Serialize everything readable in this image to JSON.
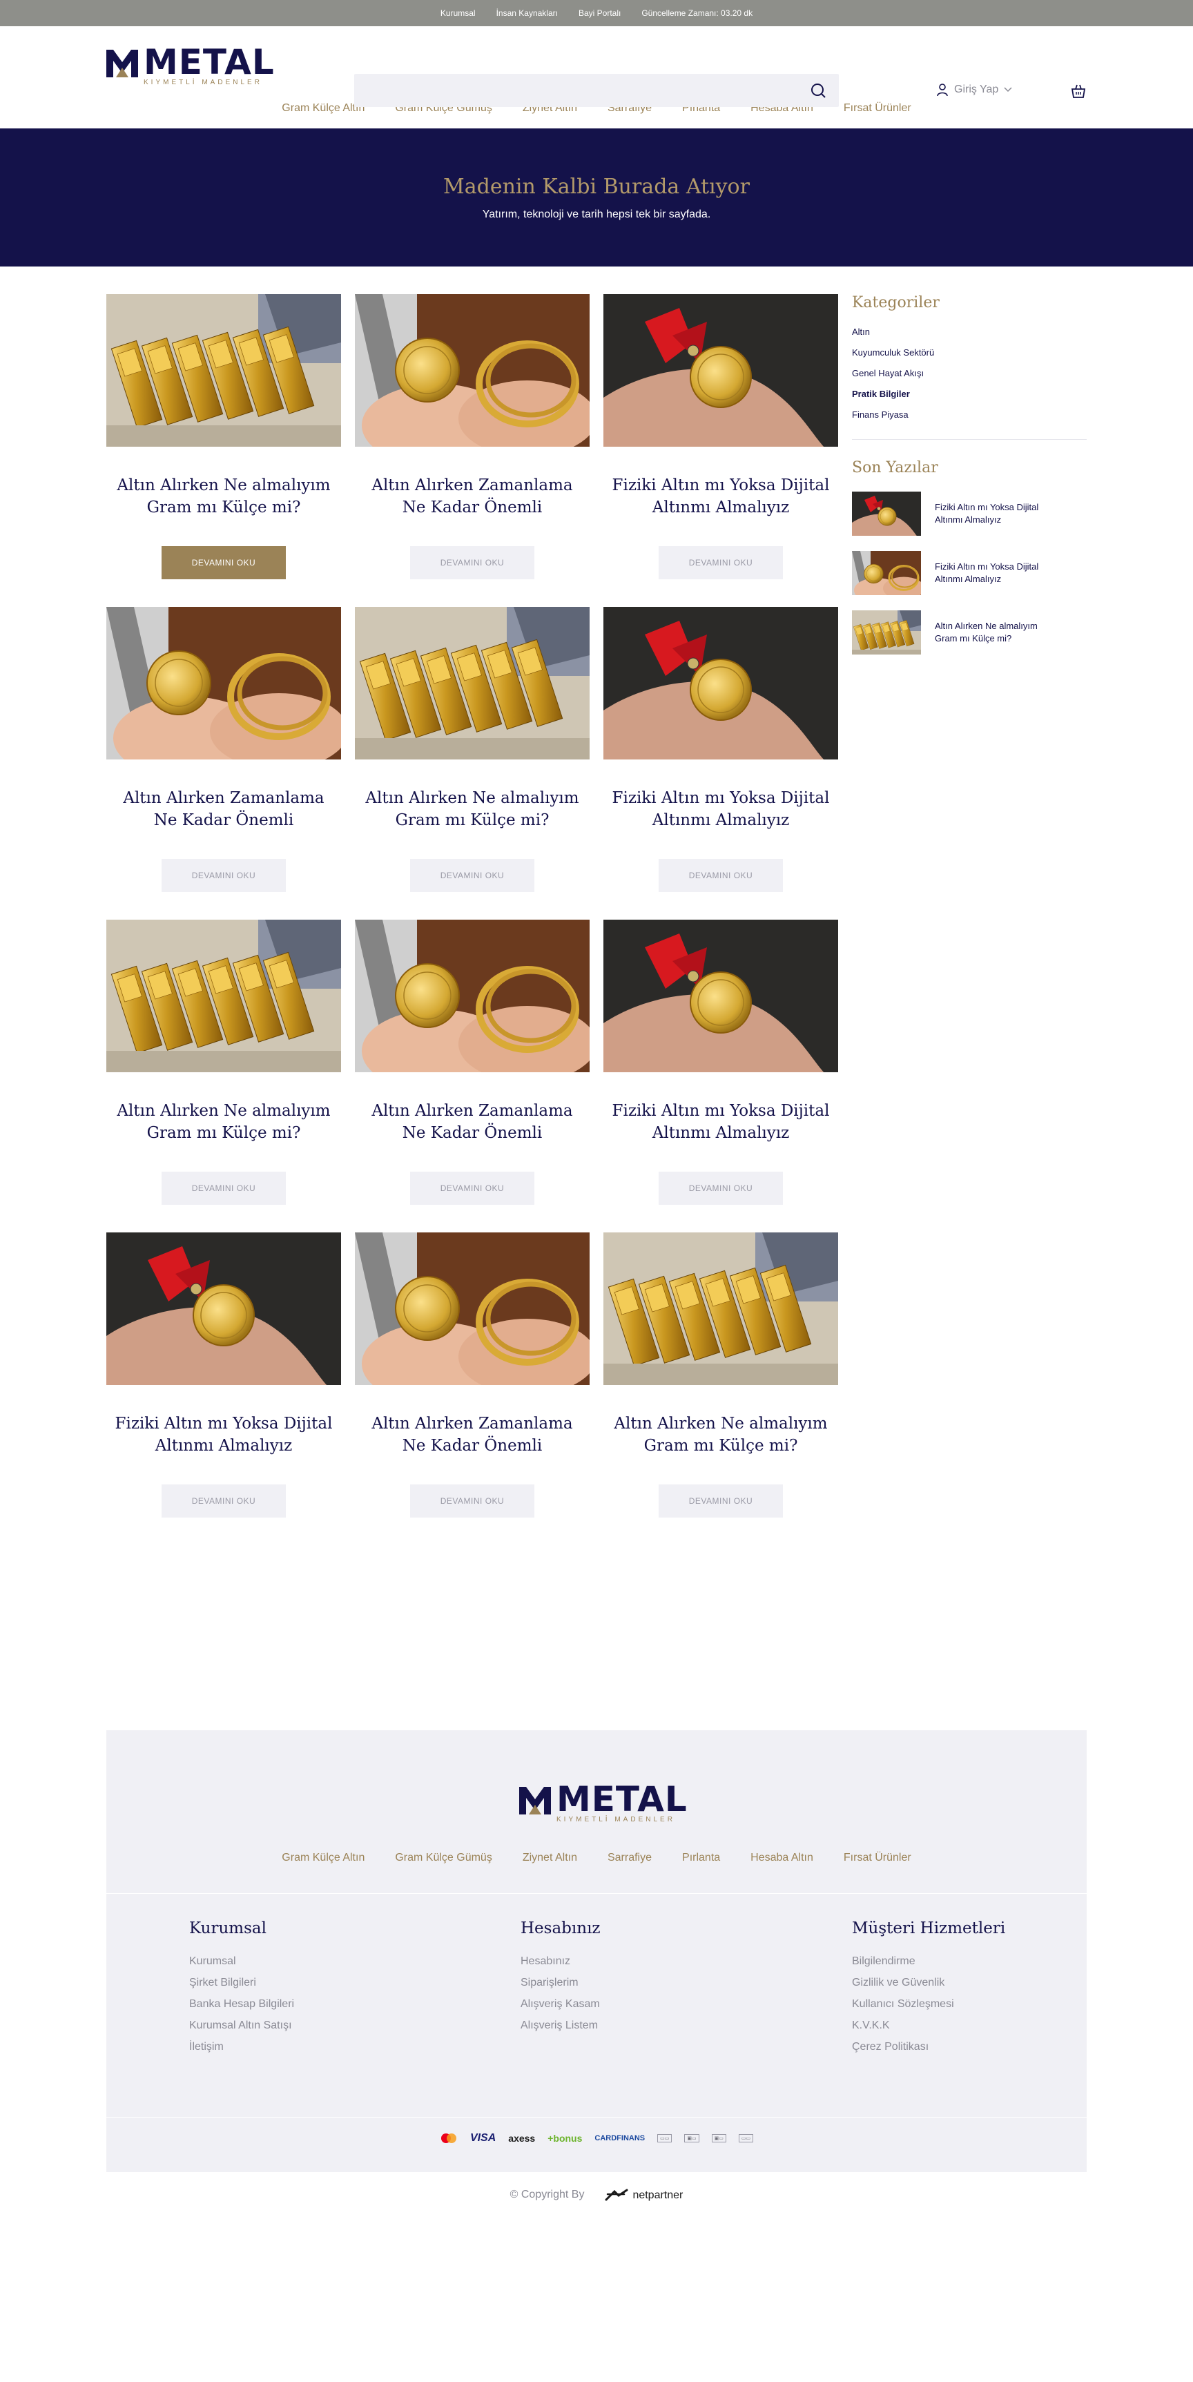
{
  "topbar": {
    "links": [
      "Kurumsal",
      "İnsan Kaynakları",
      "Bayi Portalı",
      "Güncelleme Zamanı: 03.20 dk"
    ]
  },
  "header": {
    "logo_name": "METAL",
    "logo_sub": "KIYMETLİ MADENLER",
    "login_label": "Giriş Yap"
  },
  "nav": {
    "items": [
      "Gram Külçe Altın",
      "Gram Külçe Gümüş",
      "Ziynet Altın",
      "Sarrafiye",
      "Pırlanta",
      "Hesaba Altın",
      "Fırsat Ürünler"
    ]
  },
  "hero": {
    "title": "Madenin Kalbi Burada Atıyor",
    "subtitle": "Yatırım, teknoloji ve tarih hepsi tek bir sayfada."
  },
  "posts": [
    {
      "title_line1": "Altın Alırken Ne almalıyım",
      "title_line2": "Gram mı Külçe mi?",
      "image": "gold-bars",
      "button": "DEVAMINI OKU",
      "active": true
    },
    {
      "title_line1": "Altın Alırken Zamanlama",
      "title_line2": "Ne Kadar Önemli",
      "image": "gold-coins-hand",
      "button": "DEVAMINI OKU",
      "active": false
    },
    {
      "title_line1": "Fiziki Altın mı Yoksa Dijital",
      "title_line2": "Altınmı Almalıyız",
      "image": "gold-coin-ribbon",
      "button": "DEVAMINI OKU",
      "active": false
    },
    {
      "title_line1": "Altın Alırken Zamanlama",
      "title_line2": "Ne Kadar Önemli",
      "image": "gold-coins-hand",
      "button": "DEVAMINI OKU",
      "active": false
    },
    {
      "title_line1": "Altın Alırken Ne almalıyım",
      "title_line2": "Gram mı Külçe mi?",
      "image": "gold-bars",
      "button": "DEVAMINI OKU",
      "active": false
    },
    {
      "title_line1": "Fiziki Altın mı Yoksa Dijital",
      "title_line2": "Altınmı Almalıyız",
      "image": "gold-coin-ribbon",
      "button": "DEVAMINI OKU",
      "active": false
    },
    {
      "title_line1": "Altın Alırken Ne almalıyım",
      "title_line2": "Gram mı Külçe mi?",
      "image": "gold-bars",
      "button": "DEVAMINI OKU",
      "active": false
    },
    {
      "title_line1": "Altın Alırken Zamanlama",
      "title_line2": "Ne Kadar Önemli",
      "image": "gold-coins-hand",
      "button": "DEVAMINI OKU",
      "active": false
    },
    {
      "title_line1": "Fiziki Altın mı Yoksa Dijital",
      "title_line2": "Altınmı Almalıyız",
      "image": "gold-coin-ribbon",
      "button": "DEVAMINI OKU",
      "active": false
    },
    {
      "title_line1": "Fiziki Altın mı Yoksa Dijital",
      "title_line2": "Altınmı Almalıyız",
      "image": "gold-coin-ribbon",
      "button": "DEVAMINI OKU",
      "active": false
    },
    {
      "title_line1": "Altın Alırken Zamanlama",
      "title_line2": "Ne Kadar Önemli",
      "image": "gold-coins-hand",
      "button": "DEVAMINI OKU",
      "active": false
    },
    {
      "title_line1": "Altın Alırken Ne almalıyım",
      "title_line2": "Gram mı Külçe mi?",
      "image": "gold-bars",
      "button": "DEVAMINI OKU",
      "active": false
    }
  ],
  "sidebar": {
    "categories_title": "Kategoriler",
    "categories": [
      {
        "label": "Altın",
        "bold": false
      },
      {
        "label": "Kuyumculuk Sektörü",
        "bold": false
      },
      {
        "label": "Genel Hayat Akışı",
        "bold": false
      },
      {
        "label": "Pratik Bilgiler",
        "bold": true
      },
      {
        "label": "Finans Piyasa",
        "bold": false
      }
    ],
    "recent_title": "Son Yazılar",
    "recent": [
      {
        "line1": "Fiziki Altın mı Yoksa Dijital",
        "line2": "Altınmı Almalıyız",
        "image": "gold-coin-ribbon"
      },
      {
        "line1": "Fiziki Altın mı Yoksa Dijital",
        "line2": "Altınmı Almalıyız",
        "image": "gold-coins-hand"
      },
      {
        "line1": "Altın Alırken Ne almalıyım",
        "line2": "Gram mı Külçe mi?",
        "image": "gold-bars"
      }
    ]
  },
  "footer": {
    "nav": [
      "Gram Külçe Altın",
      "Gram Külçe Gümüş",
      "Ziynet Altın",
      "Sarrafiye",
      "Pırlanta",
      "Hesaba Altın",
      "Fırsat Ürünler"
    ],
    "col1": {
      "title": "Kurumsal",
      "links": [
        "Kurumsal",
        "Şirket Bilgileri",
        "Banka Hesap Bilgileri",
        "Kurumsal Altın Satışı",
        "İletişim"
      ]
    },
    "col2": {
      "title": "Hesabınız",
      "links": [
        "Hesabınız",
        "Siparişlerim",
        "Alışveriş Kasam",
        "Alışveriş Listem"
      ]
    },
    "col3": {
      "title": "Müşteri Hizmetleri",
      "links": [
        "Bilgilendirme",
        "Gizlilik ve Güvenlik",
        "Kullanıcı Sözleşmesi",
        "K.V.K.K",
        "Çerez Politikası"
      ]
    },
    "payments": [
      "VISA",
      "axess",
      "+bonus",
      "CARDFINANS"
    ],
    "copyright": "© Copyright By",
    "brand": "netpartner"
  },
  "colors": {
    "navy": "#14124a",
    "gold": "#9b8357",
    "topbar": "#8e8f8a",
    "light": "#f0f0f5"
  }
}
